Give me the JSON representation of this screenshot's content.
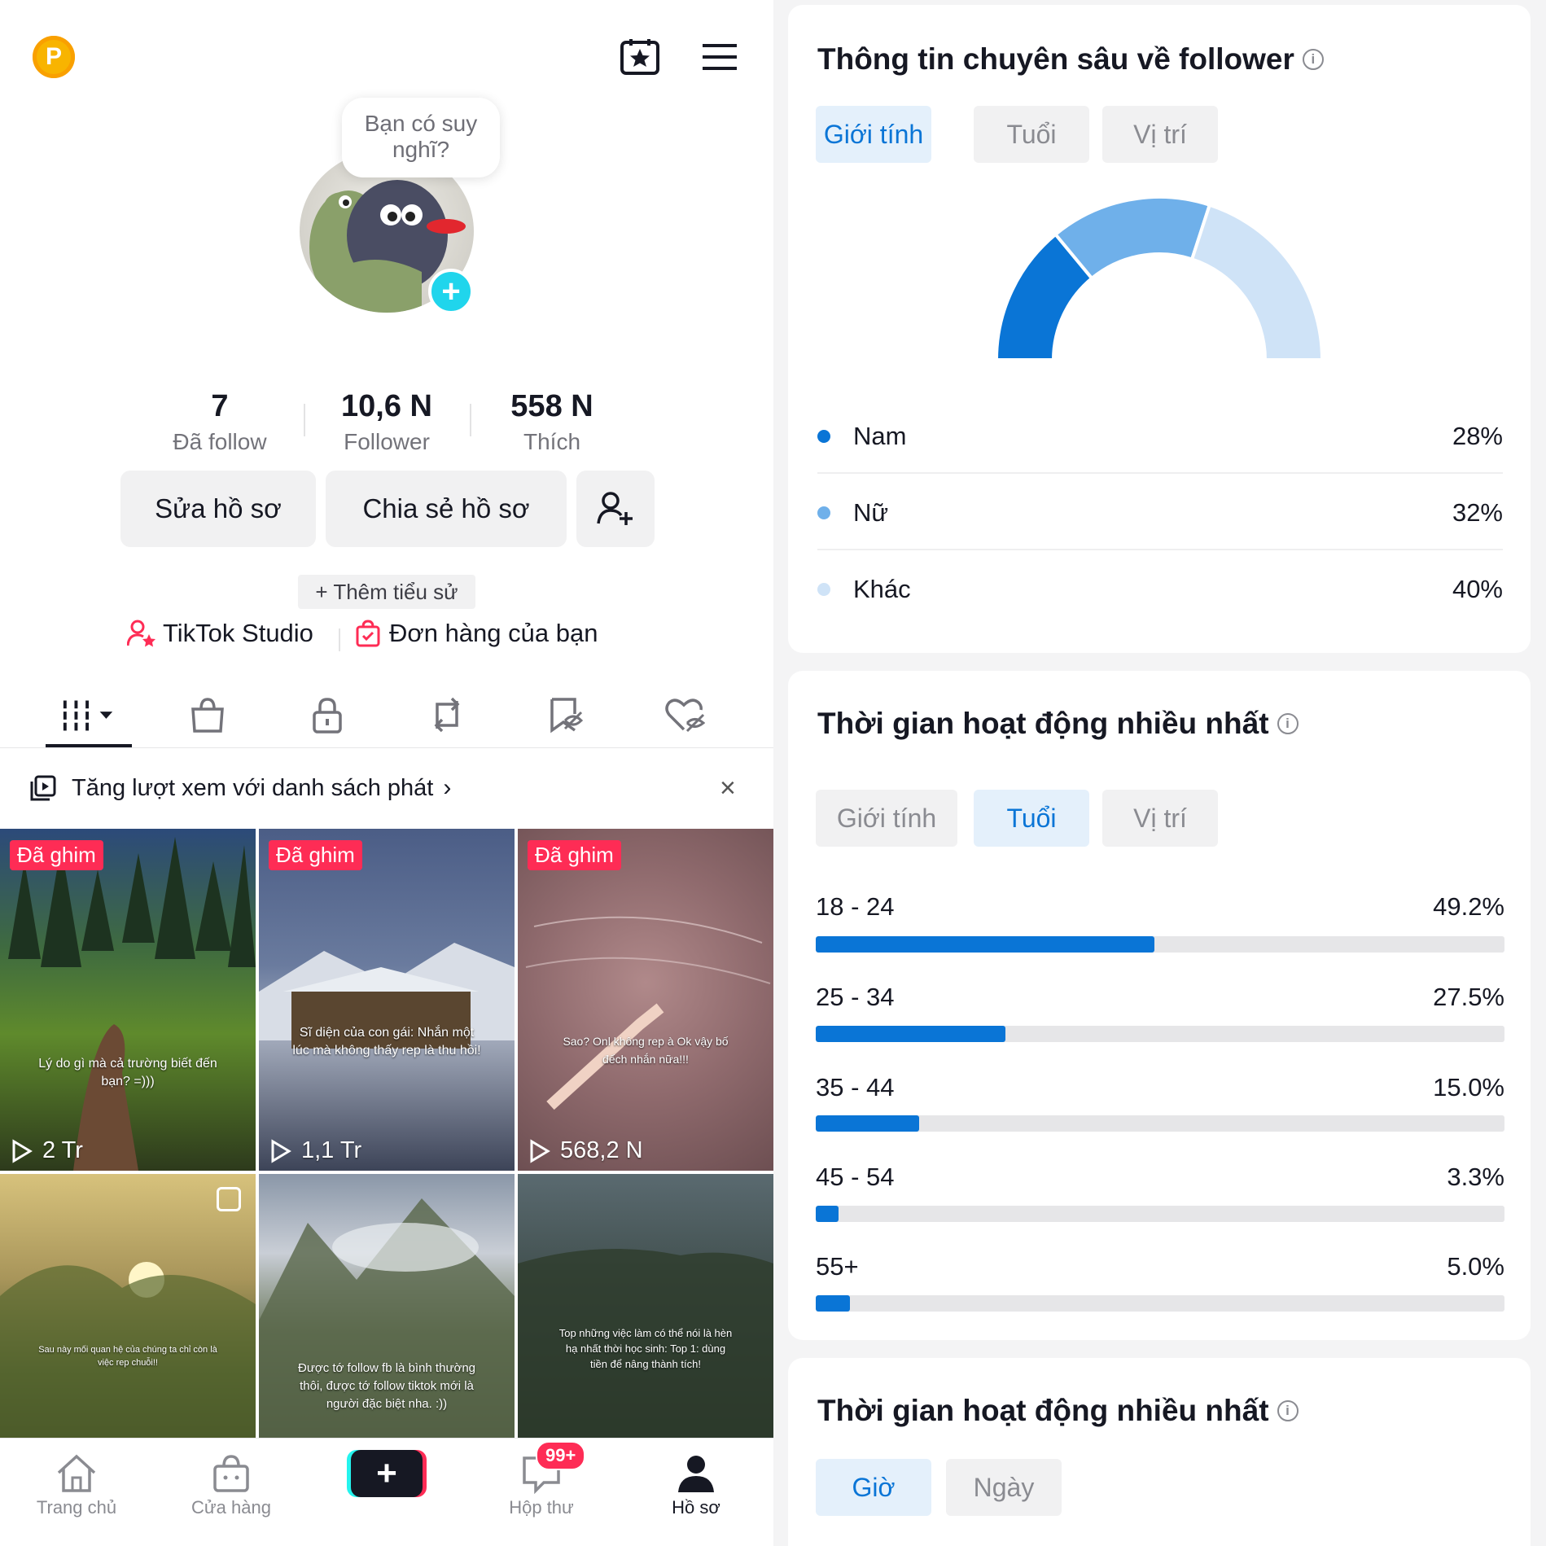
{
  "profile": {
    "bubble_text": "Bạn có suy nghĩ?",
    "stats": [
      {
        "value": "7",
        "label": "Đã follow"
      },
      {
        "value": "10,6 N",
        "label": "Follower"
      },
      {
        "value": "558 N",
        "label": "Thích"
      }
    ],
    "edit_label": "Sửa hồ sơ",
    "share_label": "Chia sẻ hồ sơ",
    "add_bio_label": "+ Thêm tiểu sử",
    "studio_label": "TikTok Studio",
    "orders_label": "Đơn hàng của bạn",
    "coin_letter": "P"
  },
  "banner": {
    "text": "Tăng lượt xem với danh sách phát"
  },
  "videos": [
    {
      "pinned": "Đã ghim",
      "caption": "Lý do gì mà cả trường biết đến bạn? =)))",
      "views": "2 Tr"
    },
    {
      "pinned": "Đã ghim",
      "caption": "Sĩ diện của con gái: Nhắn một lúc mà không thấy rep là thu hồi!",
      "views": "1,1 Tr"
    },
    {
      "pinned": "Đã ghim",
      "caption": "Sao? Onl không rep à Ok vậy bố đếch nhắn nữa!!!",
      "views": "568,2 N"
    },
    {
      "pinned": "",
      "caption": "Sau này mối quan hệ của chúng ta chỉ còn là việc rep chuỗi!!",
      "views": ""
    },
    {
      "pinned": "",
      "caption": "Được tớ follow fb là bình thường thôi, được tớ follow tiktok mới là người đặc biệt nha. :))",
      "views": ""
    },
    {
      "pinned": "",
      "caption": "Top những việc làm có thể nói là hèn hạ nhất thời học sinh: Top 1: dùng tiền để nâng thành tích!",
      "views": ""
    }
  ],
  "nav": {
    "home": "Trang chủ",
    "shop": "Cửa hàng",
    "inbox": "Hộp thư",
    "inbox_badge": "99+",
    "profile": "Hồ sơ"
  },
  "insights": {
    "title": "Thông tin chuyên sâu về follower",
    "tabs": [
      "Giới tính",
      "Tuổi",
      "Vị trí"
    ],
    "gender": [
      {
        "label": "Nam",
        "pct": "28%",
        "value": 28,
        "color": "#0a75d6"
      },
      {
        "label": "Nữ",
        "pct": "32%",
        "value": 32,
        "color": "#6fb0ea"
      },
      {
        "label": "Khác",
        "pct": "40%",
        "value": 40,
        "color": "#cfe3f7"
      }
    ]
  },
  "active_time": {
    "title": "Thời gian hoạt động nhiều nhất",
    "tabs": [
      "Giới tính",
      "Tuổi",
      "Vị trí"
    ],
    "ages": [
      {
        "label": "18 - 24",
        "pct": "49.2%",
        "value": 49.2
      },
      {
        "label": "25 - 34",
        "pct": "27.5%",
        "value": 27.5
      },
      {
        "label": "35 - 44",
        "pct": "15.0%",
        "value": 15.0
      },
      {
        "label": "45 - 54",
        "pct": "3.3%",
        "value": 3.3
      },
      {
        "label": "55+",
        "pct": "5.0%",
        "value": 5.0
      }
    ]
  },
  "active_time2": {
    "title": "Thời gian hoạt động nhiều nhất",
    "tabs": [
      "Giờ",
      "Ngày"
    ]
  },
  "chart_data": {
    "type": "pie",
    "categories": [
      "Nam",
      "Nữ",
      "Khác"
    ],
    "values": [
      28,
      32,
      40
    ],
    "title": "Thông tin chuyên sâu về follower"
  }
}
